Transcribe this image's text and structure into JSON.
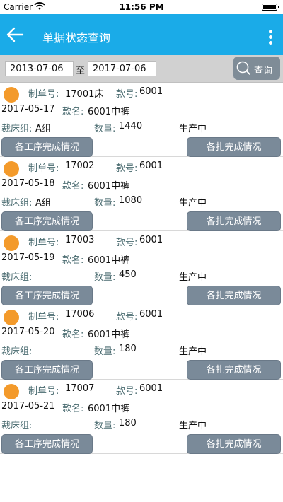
{
  "status_bar": {
    "carrier": "Carrier",
    "time": "11:56 PM",
    "icons": [
      "wifi-icon",
      "battery-icon"
    ]
  },
  "header": {
    "title": "单据状态查询",
    "back_icon": "arrow-left-icon",
    "menu_icon": "more-vertical-icon",
    "color": "#1aabe8"
  },
  "filter": {
    "start_date": "2013-07-06",
    "separator": "至",
    "end_date": "2017-07-06",
    "query_label": "查询",
    "query_icon": "search-icon"
  },
  "orders": [
    {
      "order_label": "制单号:",
      "order_no": "17001床",
      "style_label": "款号:",
      "style_no": "6001",
      "date": "2017-05-17",
      "name_label": "款名:",
      "style_name": "6001中裤",
      "group_label": "裁床组:",
      "group": "A组",
      "qty_label": "数量:",
      "qty": "1440",
      "status": "生产中",
      "process_button": "各工序完成情况",
      "bundle_button": "各扎完成情况"
    },
    {
      "order_label": "制单号:",
      "order_no": "17002",
      "style_label": "款号:",
      "style_no": "6001",
      "date": "2017-05-18",
      "name_label": "款名:",
      "style_name": "6001中裤",
      "group_label": "裁床组:",
      "group": "A组",
      "qty_label": "数量:",
      "qty": "1080",
      "status": "生产中",
      "process_button": "各工序完成情况",
      "bundle_button": "各扎完成情况"
    },
    {
      "order_label": "制单号:",
      "order_no": "17003",
      "style_label": "款号:",
      "style_no": "6001",
      "date": "2017-05-19",
      "name_label": "款名:",
      "style_name": "6001中裤",
      "group_label": "裁床组:",
      "group": "",
      "qty_label": "数量:",
      "qty": "450",
      "status": "生产中",
      "process_button": "各工序完成情况",
      "bundle_button": "各扎完成情况"
    },
    {
      "order_label": "制单号:",
      "order_no": "17006",
      "style_label": "款号:",
      "style_no": "6001",
      "date": "2017-05-20",
      "name_label": "款名:",
      "style_name": "6001中裤",
      "group_label": "裁床组:",
      "group": "",
      "qty_label": "数量:",
      "qty": "180",
      "status": "生产中",
      "process_button": "各工序完成情况",
      "bundle_button": "各扎完成情况"
    },
    {
      "order_label": "制单号:",
      "order_no": "17007",
      "style_label": "款号:",
      "style_no": "6001",
      "date": "2017-05-21",
      "name_label": "款名:",
      "style_name": "6001中裤",
      "group_label": "裁床组:",
      "group": "",
      "qty_label": "数量:",
      "qty": "180",
      "status": "生产中",
      "process_button": "各工序完成情况",
      "bundle_button": "各扎完成情况"
    }
  ],
  "colors": {
    "status_dot": "#f39a2b",
    "button_bg": "#7a8a99",
    "filter_bg": "#d1d1d1"
  }
}
